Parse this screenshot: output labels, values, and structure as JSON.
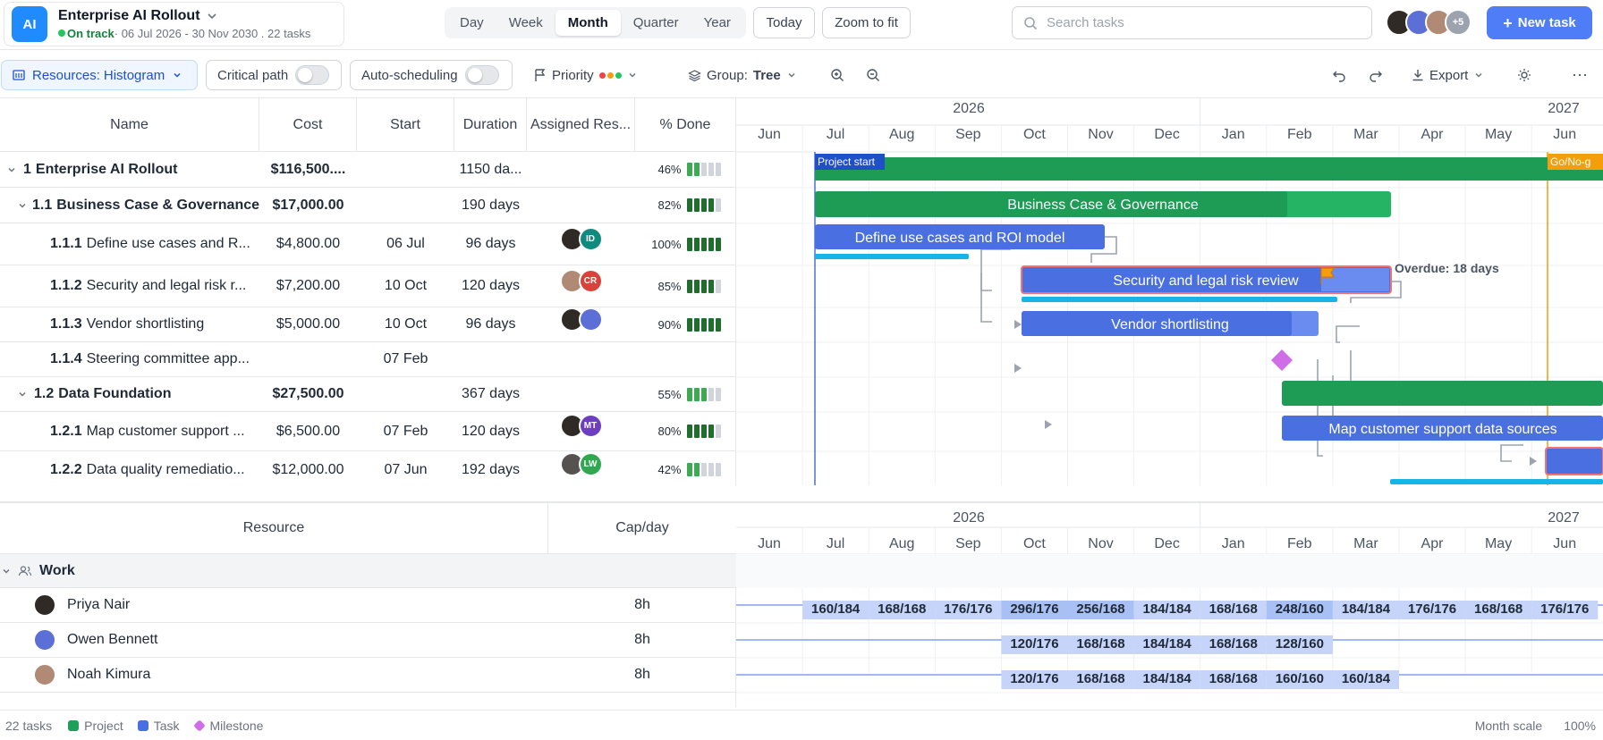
{
  "header": {
    "logo": "AI",
    "project_title": "Enterprise AI Rollout",
    "status": "On track",
    "date_range": "· 06 Jul 2026 - 30 Nov 2030 . 22 tasks",
    "views": [
      "Day",
      "Week",
      "Month",
      "Quarter",
      "Year"
    ],
    "active_view": "Month",
    "today_label": "Today",
    "zoom_fit_label": "Zoom to fit",
    "search_placeholder": "Search tasks",
    "avatar_more": "+5",
    "new_task_label": "New task"
  },
  "toolbar": {
    "resources_prefix": "Resources:",
    "resources_value": "Histogram",
    "critical_path_label": "Critical path",
    "auto_scheduling_label": "Auto-scheduling",
    "priority_label": "Priority",
    "group_prefix": "Group:",
    "group_value": "Tree",
    "export_label": "Export"
  },
  "grid": {
    "columns": [
      "Name",
      "Cost",
      "Start",
      "Duration",
      "Assigned Res...",
      "% Done"
    ],
    "rows": [
      {
        "num": "1",
        "name": "Enterprise AI Rollout",
        "cost": "$116,500....",
        "start": "",
        "duration": "1150 da...",
        "pct": "46%",
        "done": 0.46,
        "level": 0,
        "summary": true,
        "avatars": []
      },
      {
        "num": "1.1",
        "name": "Business Case & Governance",
        "cost": "$17,000.00",
        "start": "",
        "duration": "190 days",
        "pct": "82%",
        "done": 0.82,
        "level": 1,
        "summary": true,
        "avatars": []
      },
      {
        "num": "1.1.1",
        "name": "Define use cases and R...",
        "cost": "$4,800.00",
        "start": "06 Jul",
        "duration": "96 days",
        "pct": "100%",
        "done": 1.0,
        "level": 2,
        "summary": false,
        "avatars": [
          {
            "t": "",
            "c": "#2f2a26"
          },
          {
            "t": "ID",
            "c": "#0f8a7e"
          }
        ]
      },
      {
        "num": "1.1.2",
        "name": "Security and legal risk r...",
        "cost": "$7,200.00",
        "start": "10 Oct",
        "duration": "120 days",
        "pct": "85%",
        "done": 0.85,
        "level": 2,
        "summary": false,
        "avatars": [
          {
            "t": "",
            "c": "#b08a74"
          },
          {
            "t": "CR",
            "c": "#d9413b"
          }
        ]
      },
      {
        "num": "1.1.3",
        "name": "Vendor shortlisting",
        "cost": "$5,000.00",
        "start": "10 Oct",
        "duration": "96 days",
        "pct": "90%",
        "done": 0.9,
        "level": 2,
        "summary": false,
        "avatars": [
          {
            "t": "",
            "c": "#2f2a26"
          },
          {
            "t": "",
            "c": "#5b6fd6"
          }
        ]
      },
      {
        "num": "1.1.4",
        "name": "Steering committee app...",
        "cost": "",
        "start": "07 Feb",
        "duration": "",
        "pct": "",
        "done": null,
        "level": 2,
        "summary": false,
        "avatars": []
      },
      {
        "num": "1.2",
        "name": "Data Foundation",
        "cost": "$27,500.00",
        "start": "",
        "duration": "367 days",
        "pct": "55%",
        "done": 0.55,
        "level": 1,
        "summary": true,
        "avatars": []
      },
      {
        "num": "1.2.1",
        "name": "Map customer support ...",
        "cost": "$6,500.00",
        "start": "07 Feb",
        "duration": "120 days",
        "pct": "80%",
        "done": 0.8,
        "level": 2,
        "summary": false,
        "avatars": [
          {
            "t": "",
            "c": "#2f2a26"
          },
          {
            "t": "MT",
            "c": "#6d3fc0"
          }
        ]
      },
      {
        "num": "1.2.2",
        "name": "Data quality remediatio...",
        "cost": "$12,000.00",
        "start": "07 Jun",
        "duration": "192 days",
        "pct": "42%",
        "done": 0.42,
        "level": 2,
        "summary": false,
        "avatars": [
          {
            "t": "",
            "c": "#55524f"
          },
          {
            "t": "LW",
            "c": "#2fa84f"
          }
        ]
      }
    ]
  },
  "timeline": {
    "years": [
      "2026",
      "2027"
    ],
    "months": [
      "Jun",
      "Jul",
      "Aug",
      "Sep",
      "Oct",
      "Nov",
      "Dec",
      "Jan",
      "Feb",
      "Mar",
      "Apr",
      "May",
      "Jun"
    ]
  },
  "gantt": {
    "project_start_label": "Project start",
    "gono_label": "Go/No-g",
    "bars": [
      {
        "label": "Business Case & Governance"
      },
      {
        "label": "Define use cases and ROI model"
      },
      {
        "label": "Security and legal risk review"
      },
      {
        "label": "Vendor shortlisting"
      },
      {
        "label": "Map customer support data sources"
      }
    ],
    "overdue_label": "Overdue: 18 days"
  },
  "resources": {
    "columns": [
      "Resource",
      "Cap/day"
    ],
    "group": "Work",
    "people": [
      {
        "name": "Priya Nair",
        "cap": "8h",
        "cells": [
          "160/184",
          "168/168",
          "176/176",
          "296/176",
          "256/168",
          "184/184",
          "168/168",
          "248/160",
          "184/184",
          "176/176",
          "168/168",
          "176/176"
        ],
        "start": 1
      },
      {
        "name": "Owen Bennett",
        "cap": "8h",
        "cells": [
          "120/176",
          "168/168",
          "184/184",
          "168/168",
          "128/160"
        ],
        "start": 4
      },
      {
        "name": "Noah Kimura",
        "cap": "8h",
        "cells": [
          "120/176",
          "168/168",
          "184/184",
          "168/168",
          "160/160",
          "160/184"
        ],
        "start": 4
      }
    ]
  },
  "status": {
    "tasks": "22 tasks",
    "legend": [
      "Project",
      "Task",
      "Milestone"
    ],
    "scale": "Month scale",
    "zoom": "100%"
  },
  "colors": {
    "project": "#1fa05a",
    "task": "#4a6fe0",
    "milestone": "#cf6ee6",
    "accent": "#4f7cf7",
    "deadline": "#f59e0b"
  }
}
